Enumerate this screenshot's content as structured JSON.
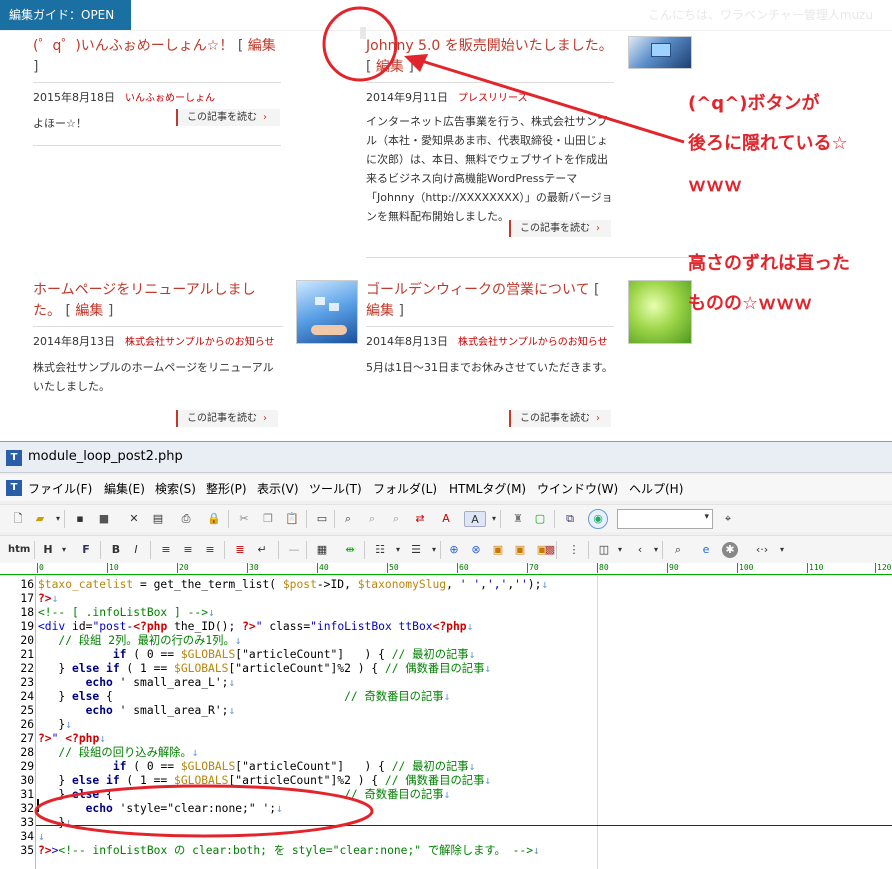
{
  "site": {
    "guide_label": "編集ガイド：OPEN",
    "greeting": "こんにちは、ワラベンチャー管理人muzu",
    "posts": [
      {
        "title": "(゜q゜)いんふぉめーしょん☆！",
        "edit": "編集",
        "date": "2015年8月18日",
        "category": "いんふぉめーしょん",
        "body": "よほー☆！",
        "more": "この記事を読む"
      },
      {
        "title": "Johnny 5.0 を販売開始いたしました。",
        "edit": "編集",
        "date": "2014年9月11日",
        "category": "プレスリリース",
        "body": "インターネット広告事業を行う、株式会社サンプル（本社・愛知県あま市、代表取締役・山田じょに次郎）は、本日、無料でウェブサイトを作成出来るビジネス向け高機能WordPressテーマ「Johnny（http://XXXXXXXX）」の最新バージョンを無料配布開始しました。",
        "more": "この記事を読む"
      },
      {
        "title": "ホームページをリニューアルしました。",
        "edit": "編集",
        "date": "2014年8月13日",
        "category": "株式会社サンプルからのお知らせ",
        "body": "株式会社サンプルのホームページをリニューアルいたしました。",
        "more": "この記事を読む"
      },
      {
        "title": "ゴールデンウィークの営業について",
        "edit": "編集",
        "date": "2014年8月13日",
        "category": "株式会社サンプルからのお知らせ",
        "body": "5月は1日～31日までお休みさせていただきます。",
        "more": "この記事を読む"
      }
    ]
  },
  "annotations": {
    "line1": "(^q^)ボタンが",
    "line2": "後ろに隠れている☆",
    "line3": "ｗｗｗ",
    "line4": "高さのずれは直った",
    "line5": "ものの☆ｗｗｗ"
  },
  "colors": {
    "annotation": "#e3242b",
    "link": "#c0392b",
    "guide_bg": "#1a6fa3"
  },
  "editor": {
    "title": "module_loop_post2.php",
    "menu": [
      "ファイル(F)",
      "編集(E)",
      "検索(S)",
      "整形(P)",
      "表示(V)",
      "ツール(T)",
      "フォルダ(L)",
      "HTMLタグ(M)",
      "ウインドウ(W)",
      "ヘルプ(H)"
    ],
    "toolbar2_first": "htm",
    "ruler": [
      "0",
      "10",
      "20",
      "30",
      "40",
      "50",
      "60",
      "70",
      "80",
      "90",
      "100",
      "110",
      "120"
    ],
    "line_numbers": [
      "16",
      "17",
      "18",
      "19",
      "20",
      "21",
      "22",
      "23",
      "24",
      "25",
      "26",
      "27",
      "28",
      "29",
      "30",
      "31",
      "32",
      "33",
      "34",
      "35"
    ]
  }
}
